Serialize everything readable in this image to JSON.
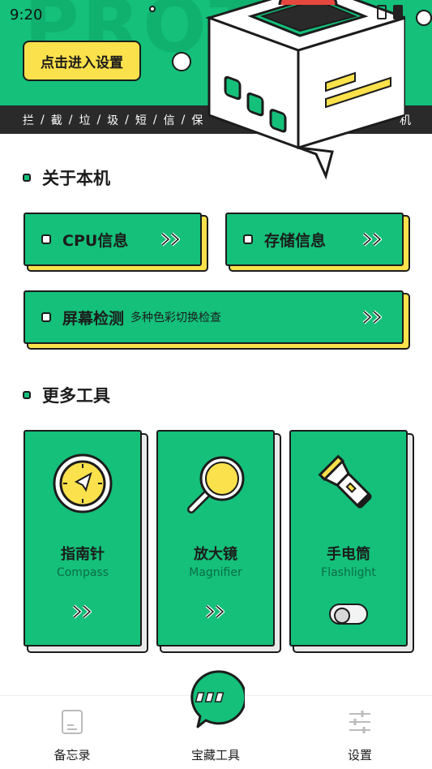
{
  "status_bar": {
    "time": "9:20"
  },
  "hero": {
    "bg_text": "PROT",
    "settings_button": "点击进入设置",
    "ticker": [
      "拦",
      "/",
      "截",
      "/",
      "垃",
      "/",
      "圾",
      "/",
      "短",
      "/",
      "信",
      "/",
      "保",
      "...",
      "机"
    ]
  },
  "about": {
    "title": "关于本机",
    "cpu": "CPU信息",
    "storage": "存储信息",
    "screen": "屏幕检测",
    "screen_sub": "多种色彩切换检查"
  },
  "tools": {
    "title": "更多工具",
    "items": [
      {
        "name": "指南针",
        "en": "Compass",
        "icon": "compass-icon"
      },
      {
        "name": "放大镜",
        "en": "Magnifier",
        "icon": "magnifier-icon"
      },
      {
        "name": "手电筒",
        "en": "Flashlight",
        "icon": "flashlight-icon"
      }
    ]
  },
  "nav": {
    "memo": "备忘录",
    "treasure": "宝藏工具",
    "settings": "设置"
  },
  "colors": {
    "green": "#14c07a",
    "yellow": "#fbe14b",
    "dark": "#1c1c1c"
  }
}
